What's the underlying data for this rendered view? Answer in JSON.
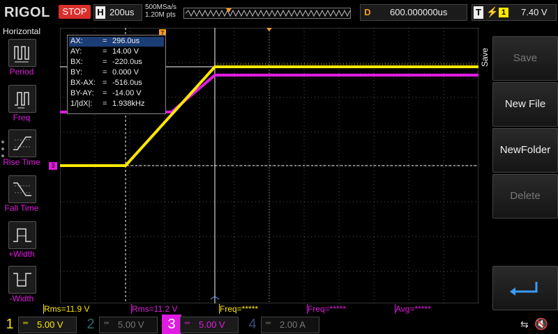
{
  "topbar": {
    "logo": "RIGOL",
    "run_state": "STOP",
    "horizontal_label": "H",
    "timebase": "200us",
    "sample_rate": "500MSa/s",
    "memory_depth": "1.20M pts",
    "delay_label": "D",
    "delay_value": "600.000000us",
    "trigger_label": "T",
    "trigger_source": "1",
    "trigger_level": "7.40 V"
  },
  "left_menu": {
    "title": "Horizontal",
    "items": [
      {
        "label": "Period",
        "icon": "period-icon"
      },
      {
        "label": "Freq",
        "icon": "freq-icon"
      },
      {
        "label": "Rise Time",
        "icon": "rise-time-icon"
      },
      {
        "label": "Fall Time",
        "icon": "fall-time-icon"
      },
      {
        "label": "+Width",
        "icon": "plus-width-icon"
      },
      {
        "label": "-Width",
        "icon": "minus-width-icon"
      }
    ]
  },
  "right_menu": {
    "title": "Save",
    "buttons": [
      {
        "label": "Save",
        "enabled": false
      },
      {
        "label": "New File",
        "enabled": true
      },
      {
        "label": "NewFolder",
        "enabled": true
      },
      {
        "label": "Delete",
        "enabled": false
      }
    ],
    "return_icon": "return-arrow-icon"
  },
  "cursor_readout": {
    "rows": [
      {
        "key": "AX:",
        "value": "296.0us"
      },
      {
        "key": "AY:",
        "value": "14.00 V"
      },
      {
        "key": "BX:",
        "value": "-220.0us"
      },
      {
        "key": "BY:",
        "value": "0.000 V"
      },
      {
        "key": "BX-AX:",
        "value": "-516.0us"
      },
      {
        "key": "BY-AY:",
        "value": "-14.00 V"
      },
      {
        "key": "1/|dX|:",
        "value": "1.938kHz"
      }
    ],
    "eq": "="
  },
  "measurements": [
    {
      "text": "Rms=11.9 V",
      "color": "#ffe800"
    },
    {
      "text": "Rms=11.2 V",
      "color": "#e01ce0"
    },
    {
      "text": "Freq=*****",
      "color": "#ffe800"
    },
    {
      "text": "Freq=*****",
      "color": "#e01ce0"
    },
    {
      "text": "Avg=*****",
      "color": "#e01ce0"
    }
  ],
  "channels": [
    {
      "num": "1",
      "coupling": "═",
      "scale": "5.00 V",
      "color": "#ffe800",
      "active": true
    },
    {
      "num": "2",
      "coupling": "═",
      "scale": "5.00 V",
      "color": "#2a6b6b",
      "active": false
    },
    {
      "num": "3",
      "coupling": "═",
      "scale": "5.00 V",
      "color": "#e01ce0",
      "active": true
    },
    {
      "num": "4",
      "coupling": "═",
      "scale": "2.00 A",
      "color": "#3a4a7a",
      "active": false
    }
  ],
  "markers": {
    "ch3_marker": "3",
    "trigger_marker": "T"
  },
  "colors": {
    "ch1": "#ffe800",
    "ch3": "#e01ce0",
    "trigger": "#ff9b1e",
    "grid": "#555555"
  }
}
